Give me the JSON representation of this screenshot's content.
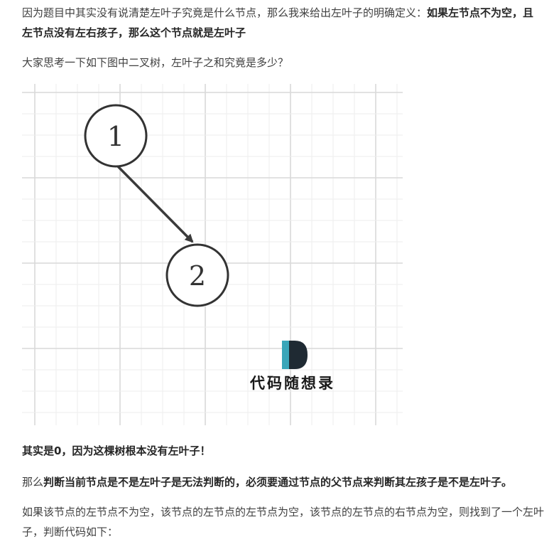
{
  "intro": {
    "plain": "因为题目中其实没有说清楚左叶子究竟是什么节点，那么我来给出左叶子的明确定义：",
    "bold": "如果左节点不为空，且左节点没有左右孩子，那么这个节点就是左叶子"
  },
  "question": "大家思考一下如下图中二叉树，左叶子之和究竟是多少？",
  "figure": {
    "node_root_label": "1",
    "node_child_label": "2",
    "watermark_letter": "D",
    "watermark_text": "代码随想录",
    "colors": {
      "grid_major": "#d9d9d9",
      "grid_minor": "#eeeeee",
      "node_stroke": "#333333",
      "edge": "#3a3a3a",
      "logo_teal": "#3aa6b9",
      "logo_dark": "#1f2a33"
    }
  },
  "answer": "其实是0，因为这棵树根本没有左叶子！",
  "judge": {
    "prefix": "那么",
    "bold": "判断当前节点是不是左叶子是无法判断的，必须要通过节点的父节点来判断其左孩子是不是左叶子。"
  },
  "condition": "如果该节点的左节点不为空，该节点的左节点的左节点为空，该节点的左节点的右节点为空，则找到了一个左叶子，判断代码如下："
}
